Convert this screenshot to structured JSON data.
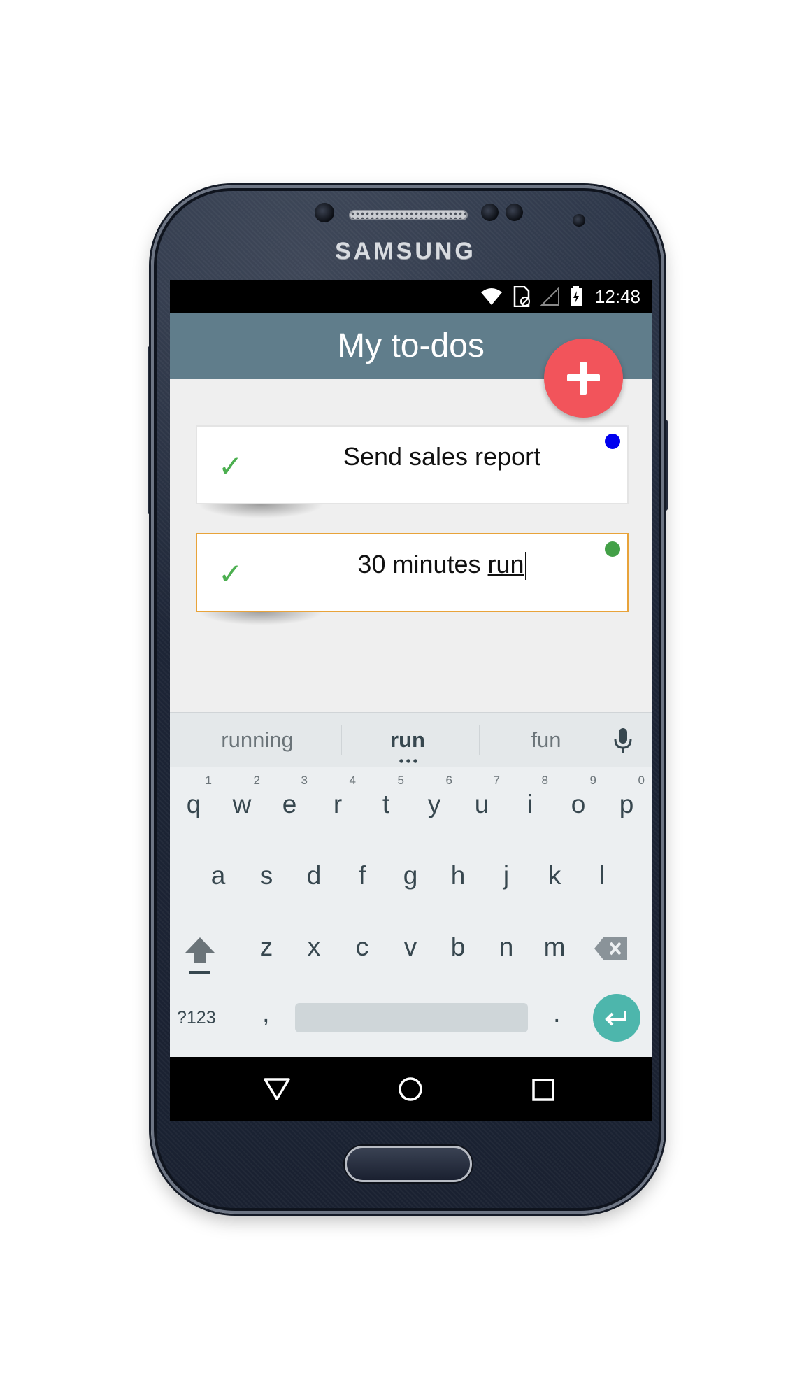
{
  "device": {
    "brand": "SAMSUNG"
  },
  "status_bar": {
    "time": "12:48",
    "icons": [
      "wifi-icon",
      "sim-card-icon",
      "cell-signal-icon",
      "battery-charging-icon"
    ]
  },
  "app_bar": {
    "title": "My to-dos"
  },
  "fab": {
    "icon": "plus-icon",
    "color": "#f2545b"
  },
  "todos": [
    {
      "text": "Send sales report",
      "done_icon": "check-icon",
      "dot_color": "#0000ee",
      "editing": false
    },
    {
      "text_prefix": "30 minutes ",
      "text_composing": "run",
      "done_icon": "check-icon",
      "dot_color": "#43a047",
      "editing": true
    }
  ],
  "keyboard": {
    "suggestions": [
      {
        "label": "running",
        "primary": false
      },
      {
        "label": "run",
        "primary": true
      },
      {
        "label": "fun",
        "primary": false
      }
    ],
    "rows": [
      [
        {
          "k": "q",
          "n": "1"
        },
        {
          "k": "w",
          "n": "2"
        },
        {
          "k": "e",
          "n": "3"
        },
        {
          "k": "r",
          "n": "4"
        },
        {
          "k": "t",
          "n": "5"
        },
        {
          "k": "y",
          "n": "6"
        },
        {
          "k": "u",
          "n": "7"
        },
        {
          "k": "i",
          "n": "8"
        },
        {
          "k": "o",
          "n": "9"
        },
        {
          "k": "p",
          "n": "0"
        }
      ],
      [
        {
          "k": "a"
        },
        {
          "k": "s"
        },
        {
          "k": "d"
        },
        {
          "k": "f"
        },
        {
          "k": "g"
        },
        {
          "k": "h"
        },
        {
          "k": "j"
        },
        {
          "k": "k"
        },
        {
          "k": "l"
        }
      ],
      [
        {
          "k": "z"
        },
        {
          "k": "x"
        },
        {
          "k": "c"
        },
        {
          "k": "v"
        },
        {
          "k": "b"
        },
        {
          "k": "n"
        },
        {
          "k": "m"
        }
      ]
    ],
    "symbols_label": "?123",
    "comma": ",",
    "period": ".",
    "accent_color": "#4db6ac"
  },
  "nav_bar": {
    "icons": [
      "back-icon",
      "home-icon",
      "recents-icon"
    ]
  }
}
